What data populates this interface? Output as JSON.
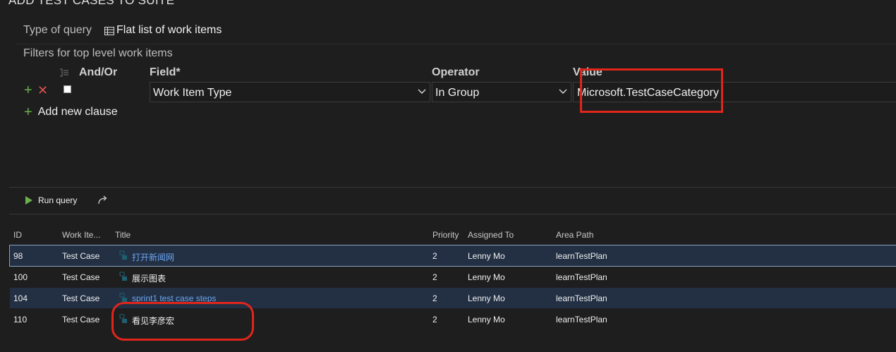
{
  "dialog": {
    "title": "ADD TEST CASES TO SUITE"
  },
  "query_type": {
    "label": "Type of query",
    "value": "Flat list of work items",
    "icon": "grid-icon"
  },
  "filters": {
    "label": "Filters for top level work items",
    "columns": {
      "andor": "And/Or",
      "field": "Field*",
      "operator": "Operator",
      "value": "Value"
    },
    "clause": {
      "field": "Work Item Type",
      "operator": "In Group",
      "value": "Microsoft.TestCaseCategory"
    },
    "add_new_clause": "Add new clause"
  },
  "toolbar": {
    "run_query": "Run query"
  },
  "results": {
    "columns": [
      "ID",
      "Work Ite...",
      "Title",
      "Priority",
      "Assigned To",
      "Area Path"
    ],
    "rows": [
      {
        "id": "98",
        "type": "Test Case",
        "title": "打开新闻网",
        "priority": "2",
        "assigned": "Lenny Mo",
        "area": "learnTestPlan"
      },
      {
        "id": "100",
        "type": "Test Case",
        "title": "展示图表",
        "priority": "2",
        "assigned": "Lenny Mo",
        "area": "learnTestPlan"
      },
      {
        "id": "104",
        "type": "Test Case",
        "title": "sprint1 test case steps",
        "priority": "2",
        "assigned": "Lenny Mo",
        "area": "learnTestPlan"
      },
      {
        "id": "110",
        "type": "Test Case",
        "title": "看见李彦宏",
        "priority": "2",
        "assigned": "Lenny Mo",
        "area": "learnTestPlan"
      }
    ]
  },
  "colors": {
    "accent_green": "#6ab04c",
    "remove_red": "#e05050",
    "annotation_red": "#e0251b",
    "link_blue": "#6aa5f0",
    "selection_bg": "#233044"
  }
}
